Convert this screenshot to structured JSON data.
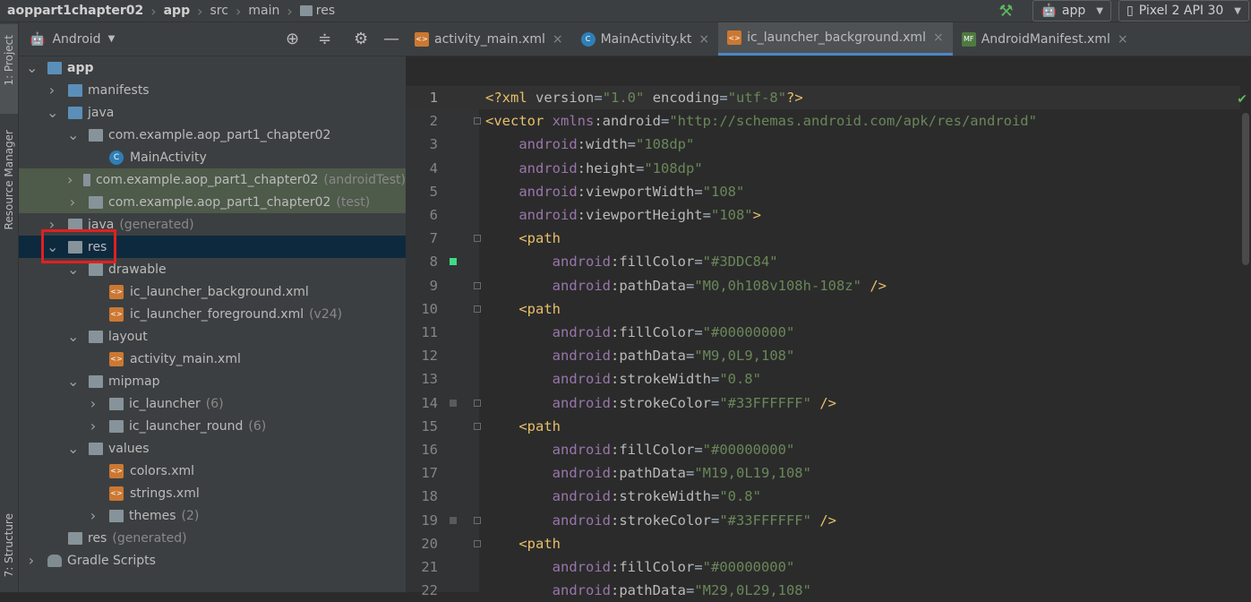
{
  "breadcrumb": {
    "items": [
      "aoppart1chapter02",
      "app",
      "src",
      "main",
      "res"
    ]
  },
  "toolbar": {
    "run_config": "app",
    "device": "Pixel 2 API 30"
  },
  "side_strip": {
    "project": "1: Project",
    "resource_manager": "Resource Manager",
    "structure": "7: Structure"
  },
  "project_panel": {
    "view_mode": "Android"
  },
  "tree": [
    {
      "label": "app",
      "extra": "",
      "indent": 0,
      "arrow": "down",
      "icon": "app-folder",
      "bold": true
    },
    {
      "label": "manifests",
      "extra": "",
      "indent": 1,
      "arrow": "right",
      "icon": "folder-blue"
    },
    {
      "label": "java",
      "extra": "",
      "indent": 1,
      "arrow": "down",
      "icon": "folder-blue"
    },
    {
      "label": "com.example.aop_part1_chapter02",
      "extra": "",
      "indent": 2,
      "arrow": "down",
      "icon": "package"
    },
    {
      "label": "MainActivity",
      "extra": "",
      "indent": 3,
      "arrow": "",
      "icon": "kotlin"
    },
    {
      "label": "com.example.aop_part1_chapter02",
      "extra": "(androidTest)",
      "indent": 2,
      "arrow": "right",
      "icon": "package",
      "test": true
    },
    {
      "label": "com.example.aop_part1_chapter02",
      "extra": "(test)",
      "indent": 2,
      "arrow": "right",
      "icon": "package",
      "test": true
    },
    {
      "label": "java",
      "extra": "(generated)",
      "indent": 1,
      "arrow": "right",
      "icon": "folder-gen"
    },
    {
      "label": "res",
      "extra": "",
      "indent": 1,
      "arrow": "down",
      "icon": "res-folder",
      "selected": true
    },
    {
      "label": "drawable",
      "extra": "",
      "indent": 2,
      "arrow": "down",
      "icon": "package"
    },
    {
      "label": "ic_launcher_background.xml",
      "extra": "",
      "indent": 3,
      "arrow": "",
      "icon": "xml"
    },
    {
      "label": "ic_launcher_foreground.xml",
      "extra": "(v24)",
      "indent": 3,
      "arrow": "",
      "icon": "xml"
    },
    {
      "label": "layout",
      "extra": "",
      "indent": 2,
      "arrow": "down",
      "icon": "package"
    },
    {
      "label": "activity_main.xml",
      "extra": "",
      "indent": 3,
      "arrow": "",
      "icon": "xml"
    },
    {
      "label": "mipmap",
      "extra": "",
      "indent": 2,
      "arrow": "down",
      "icon": "package"
    },
    {
      "label": "ic_launcher",
      "extra": "(6)",
      "indent": 3,
      "arrow": "right",
      "icon": "package"
    },
    {
      "label": "ic_launcher_round",
      "extra": "(6)",
      "indent": 3,
      "arrow": "right",
      "icon": "package"
    },
    {
      "label": "values",
      "extra": "",
      "indent": 2,
      "arrow": "down",
      "icon": "package"
    },
    {
      "label": "colors.xml",
      "extra": "",
      "indent": 3,
      "arrow": "",
      "icon": "xml"
    },
    {
      "label": "strings.xml",
      "extra": "",
      "indent": 3,
      "arrow": "",
      "icon": "xml"
    },
    {
      "label": "themes",
      "extra": "(2)",
      "indent": 3,
      "arrow": "right",
      "icon": "package"
    },
    {
      "label": "res",
      "extra": "(generated)",
      "indent": 1,
      "arrow": "",
      "icon": "res-folder"
    },
    {
      "label": "Gradle Scripts",
      "extra": "",
      "indent": 0,
      "arrow": "right",
      "icon": "gradle"
    }
  ],
  "tabs": [
    {
      "label": "activity_main.xml",
      "icon": "xml",
      "active": false
    },
    {
      "label": "MainActivity.kt",
      "icon": "kotlin",
      "active": false
    },
    {
      "label": "ic_launcher_background.xml",
      "icon": "xml",
      "active": true
    },
    {
      "label": "AndroidManifest.xml",
      "icon": "manifest",
      "active": false
    }
  ],
  "code_lines": [
    {
      "n": "1",
      "code": "<?xml version=\"1.0\" encoding=\"utf-8\"?>"
    },
    {
      "n": "2",
      "code": "<vector xmlns:android=\"http://schemas.android.com/apk/res/android\""
    },
    {
      "n": "3",
      "code": "    android:width=\"108dp\""
    },
    {
      "n": "4",
      "code": "    android:height=\"108dp\""
    },
    {
      "n": "5",
      "code": "    android:viewportWidth=\"108\""
    },
    {
      "n": "6",
      "code": "    android:viewportHeight=\"108\">"
    },
    {
      "n": "7",
      "code": "    <path"
    },
    {
      "n": "8",
      "code": "        android:fillColor=\"#3DDC84\""
    },
    {
      "n": "9",
      "code": "        android:pathData=\"M0,0h108v108h-108z\" />"
    },
    {
      "n": "10",
      "code": "    <path"
    },
    {
      "n": "11",
      "code": "        android:fillColor=\"#00000000\""
    },
    {
      "n": "12",
      "code": "        android:pathData=\"M9,0L9,108\""
    },
    {
      "n": "13",
      "code": "        android:strokeWidth=\"0.8\""
    },
    {
      "n": "14",
      "code": "        android:strokeColor=\"#33FFFFFF\" />"
    },
    {
      "n": "15",
      "code": "    <path"
    },
    {
      "n": "16",
      "code": "        android:fillColor=\"#00000000\""
    },
    {
      "n": "17",
      "code": "        android:pathData=\"M19,0L19,108\""
    },
    {
      "n": "18",
      "code": "        android:strokeWidth=\"0.8\""
    },
    {
      "n": "19",
      "code": "        android:strokeColor=\"#33FFFFFF\" />"
    },
    {
      "n": "20",
      "code": "    <path"
    },
    {
      "n": "21",
      "code": "        android:fillColor=\"#00000000\""
    },
    {
      "n": "22",
      "code": "        android:pathData=\"M29,0L29,108\""
    }
  ],
  "colors": {
    "accent": "#4a88c7",
    "swatch_line8": "#3DDC84",
    "highlight_box": "#e02020"
  }
}
